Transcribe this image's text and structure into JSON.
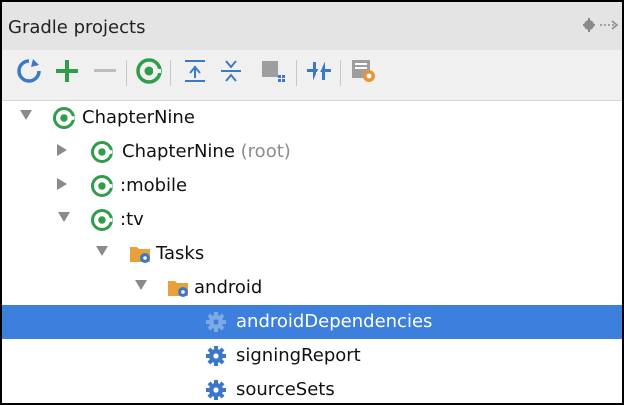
{
  "panel": {
    "title": "Gradle projects"
  },
  "toolbar": {
    "items": [
      {
        "name": "refresh-all-projects-icon"
      },
      {
        "name": "add-project-icon"
      },
      {
        "name": "remove-project-icon"
      },
      {
        "name": "execute-gradle-task-icon"
      },
      {
        "name": "expand-all-icon"
      },
      {
        "name": "collapse-all-icon"
      },
      {
        "name": "group-tasks-icon"
      },
      {
        "name": "toggle-offline-mode-icon"
      },
      {
        "name": "gradle-settings-icon"
      }
    ]
  },
  "tree": {
    "rows": [
      {
        "label": "ChapterNine",
        "suffix": "",
        "icon": "gradle-project-icon",
        "expanded": true
      },
      {
        "label": "ChapterNine",
        "suffix": "(root)",
        "icon": "gradle-module-icon",
        "expanded": false
      },
      {
        "label": ":mobile",
        "suffix": "",
        "icon": "gradle-module-icon",
        "expanded": false
      },
      {
        "label": ":tv",
        "suffix": "",
        "icon": "gradle-module-icon",
        "expanded": true
      },
      {
        "label": "Tasks",
        "suffix": "",
        "icon": "tasks-folder-icon",
        "expanded": true
      },
      {
        "label": "android",
        "suffix": "",
        "icon": "tasks-folder-icon",
        "expanded": true
      },
      {
        "label": "androidDependencies",
        "suffix": "",
        "icon": "gear-icon",
        "selected": true
      },
      {
        "label": "signingReport",
        "suffix": "",
        "icon": "gear-icon"
      },
      {
        "label": "sourceSets",
        "suffix": "",
        "icon": "gear-icon"
      }
    ]
  },
  "colors": {
    "header_bg": "#e4e4e4",
    "toolbar_bg": "#f0f0f0",
    "selection": "#3d7fdc",
    "gradle_green": "#2f9d4a",
    "accent_blue": "#3c78c8"
  }
}
